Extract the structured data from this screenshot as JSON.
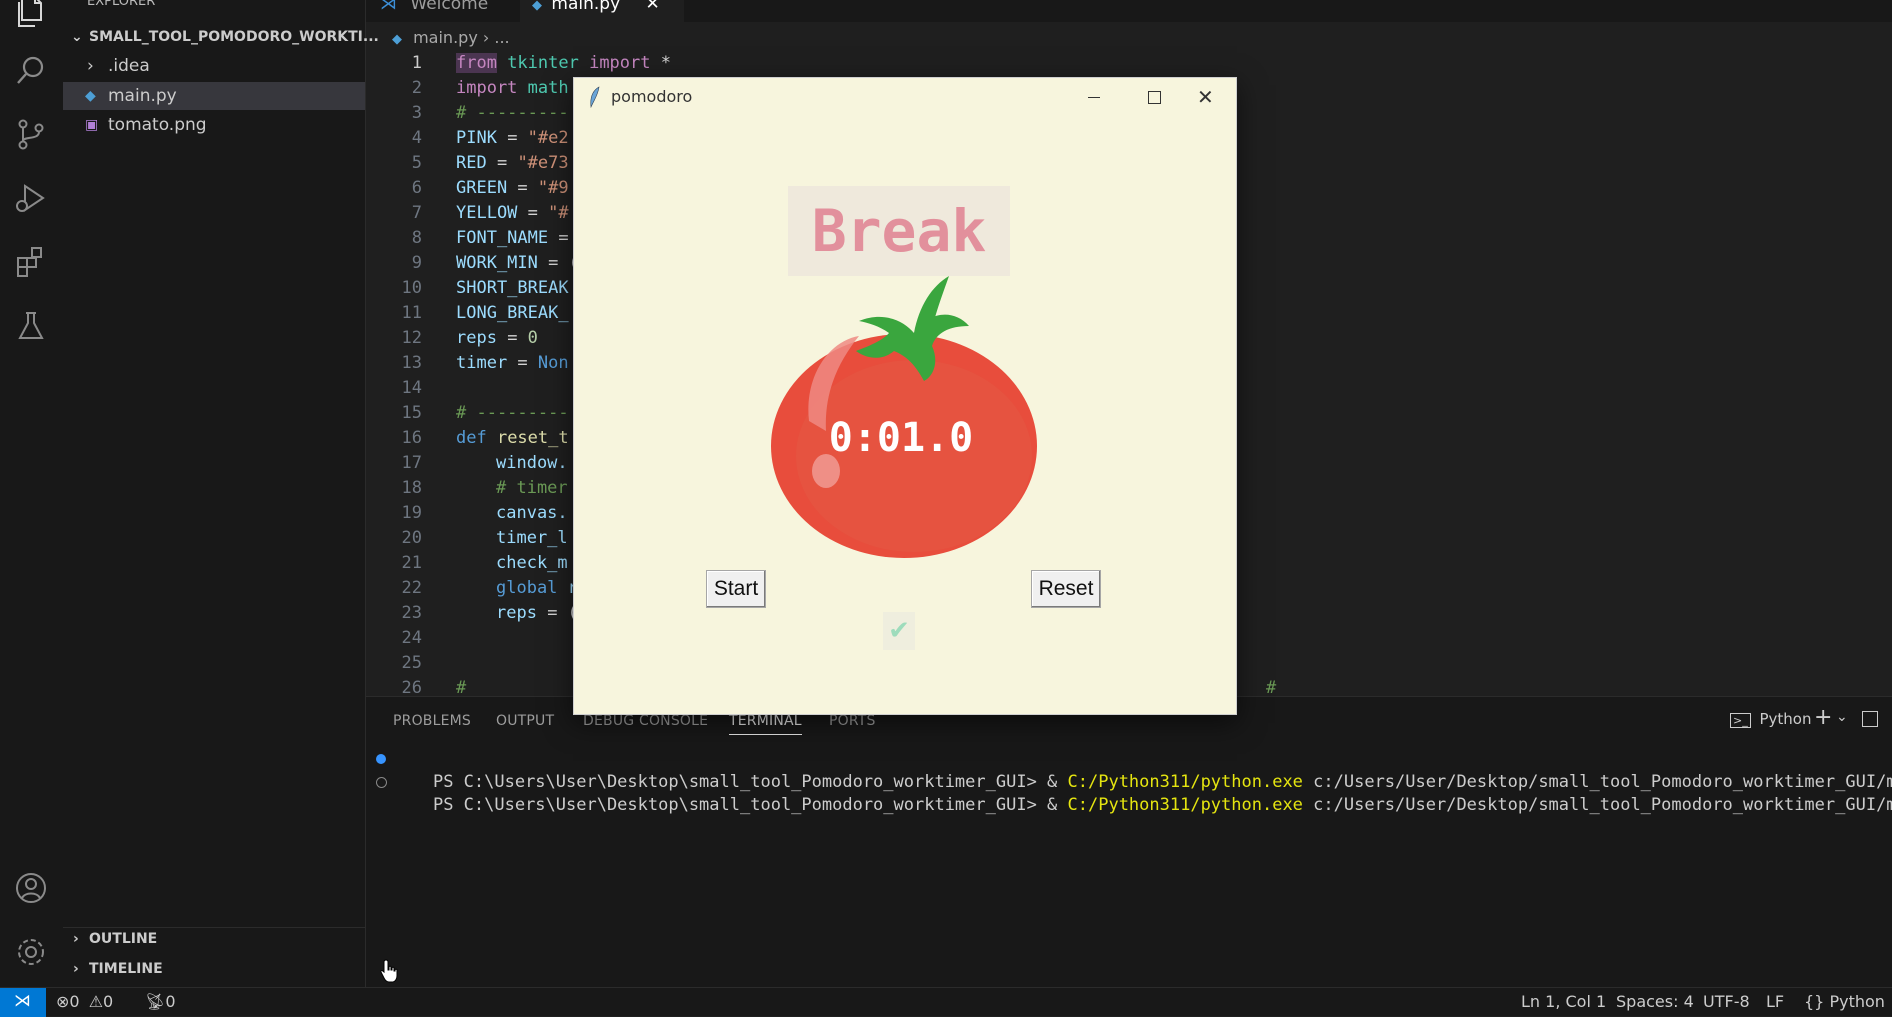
{
  "explorer": {
    "header": "EXPLORER",
    "project": "SMALL_TOOL_POMODORO_WORKTI...",
    "items": [
      {
        "label": ".idea"
      },
      {
        "label": "main.py"
      },
      {
        "label": "tomato.png"
      }
    ],
    "outline": "OUTLINE",
    "timeline": "TIMELINE"
  },
  "tabs": [
    {
      "label": "Welcome"
    },
    {
      "label": "main.py"
    }
  ],
  "breadcrumb": {
    "file": "main.py",
    "rest": "..."
  },
  "code": {
    "line_numbers": [
      "1",
      "2",
      "3",
      "4",
      "5",
      "6",
      "7",
      "8",
      "9",
      "10",
      "11",
      "12",
      "13",
      "14",
      "15",
      "16",
      "17",
      "18",
      "19",
      "20",
      "21",
      "22",
      "23",
      "24",
      "25",
      "26"
    ],
    "l1": {
      "a": "from",
      "b": " tkinter ",
      "c": "import",
      "d": " *"
    },
    "l2": {
      "a": "import",
      "b": " math"
    },
    "l3": "# ---------",
    "l4": {
      "a": "PINK",
      "b": " = ",
      "c": "\"#e2"
    },
    "l5": {
      "a": "RED",
      "b": " = ",
      "c": "\"#e73"
    },
    "l6": {
      "a": "GREEN",
      "b": " = ",
      "c": "\"#9"
    },
    "l7": {
      "a": "YELLOW",
      "b": " = ",
      "c": "\"#"
    },
    "l8": {
      "a": "FONT_NAME",
      "b": " ="
    },
    "l9": {
      "a": "WORK_MIN",
      "b": " = ",
      "c": "("
    },
    "l10": "SHORT_BREAK",
    "l11": "LONG_BREAK_",
    "l12": {
      "a": "reps",
      "b": " = ",
      "c": "0"
    },
    "l13": {
      "a": "timer",
      "b": " = ",
      "c": "Non"
    },
    "l15": "# ---------",
    "l16": {
      "a": "def",
      "b": " reset_t"
    },
    "l17": "window.",
    "l18": "# timer",
    "l19": "canvas.",
    "l20": "timer_l",
    "l21": "check_m",
    "l22": {
      "a": "global",
      "b": " r"
    },
    "l23": {
      "a": "reps",
      "b": " = ",
      "c": "("
    },
    "l26": "#",
    "l26b": "#"
  },
  "panel": {
    "tabs": [
      "PROBLEMS",
      "OUTPUT",
      "DEBUG CONSOLE",
      "TERMINAL",
      "PORTS"
    ],
    "active_tab": "TERMINAL",
    "shell": "Python",
    "lines": [
      {
        "prompt": "PS C:\\Users\\User\\Desktop\\small_tool_Pomodoro_worktimer_GUI> & ",
        "exe": "C:/Python311/python.exe",
        "arg": " c:/Users/User/Desktop/small_tool_Pomodoro_worktimer_GUI/main.py"
      },
      {
        "prompt": "PS C:\\Users\\User\\Desktop\\small_tool_Pomodoro_worktimer_GUI> & ",
        "exe": "C:/Python311/python.exe",
        "arg": " c:/Users/User/Desktop/small_tool_Pomodoro_worktimer_GUI/main.py"
      }
    ]
  },
  "status": {
    "errors": "0",
    "warnings": "0",
    "ports": "0",
    "position": "Ln 1, Col 1",
    "spaces": "Spaces: 4",
    "encoding": "UTF-8",
    "eol": "LF",
    "language": "Python"
  },
  "pomodoro": {
    "title": "pomodoro",
    "label": "Break",
    "timer": "0:01.0",
    "start": "Start",
    "reset": "Reset",
    "check": "✔",
    "colors": {
      "bg": "#f7f5dd",
      "label": "#e2909c",
      "tomato": "#e84d3c",
      "leaf": "#3aa63e",
      "check": "#9edcbc"
    }
  }
}
